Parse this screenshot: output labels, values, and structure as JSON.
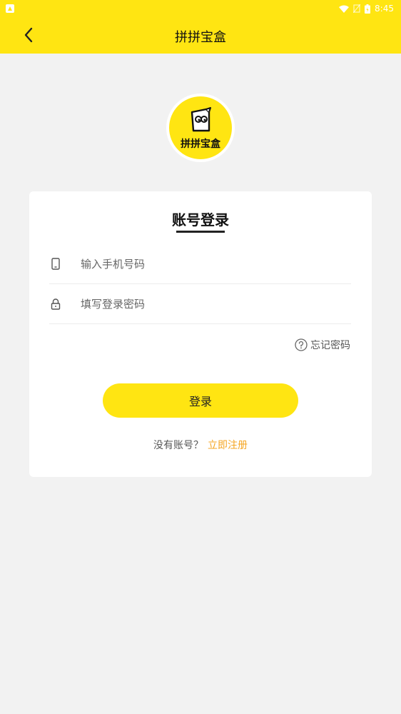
{
  "status_bar": {
    "time": "8:45"
  },
  "header": {
    "title": "拼拼宝盒",
    "back_icon": "chevron-left-icon"
  },
  "logo": {
    "text": "拼拼宝盒",
    "background": "#ffe512"
  },
  "login_card": {
    "title": "账号登录",
    "phone_placeholder": "输入手机号码",
    "password_placeholder": "填写登录密码",
    "forgot_password": "忘记密码",
    "login_button": "登录",
    "register_prompt": "没有账号？",
    "register_link": "立即注册"
  },
  "colors": {
    "accent": "#ffe512",
    "link": "#f5a623",
    "background": "#f2f2f2"
  }
}
